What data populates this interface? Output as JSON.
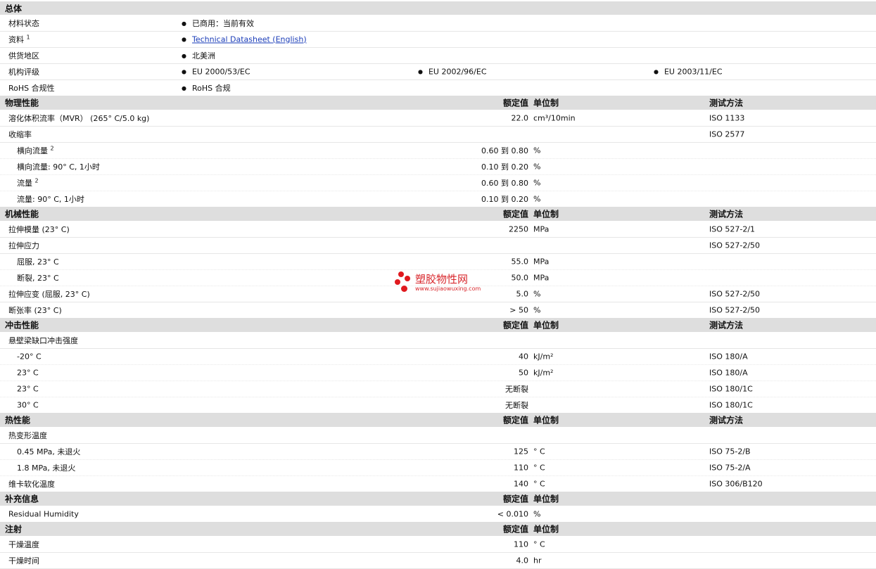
{
  "general": {
    "title": "总体",
    "rows": [
      {
        "label": "材料状态",
        "items": [
          "已商用：当前有效"
        ]
      },
      {
        "label": "资料",
        "sup": "1",
        "link": "Technical Datasheet (English)"
      },
      {
        "label": "供货地区",
        "items": [
          "北美洲"
        ]
      },
      {
        "label": "机构评级",
        "items": [
          "EU 2000/53/EC",
          "EU 2002/96/EC",
          "EU 2003/11/EC"
        ]
      },
      {
        "label": "RoHS 合规性",
        "items": [
          "RoHS 合规"
        ]
      }
    ]
  },
  "headers": {
    "value": "额定值",
    "unit": "单位制",
    "method": "测试方法"
  },
  "sections": [
    {
      "title": "物理性能",
      "has_method": true,
      "rows": [
        {
          "label": "溶化体积流率（MVR） (265° C/5.0 kg)",
          "value": "22.0",
          "unit": "cm³/10min",
          "method": "ISO 1133"
        },
        {
          "label": "收缩率",
          "value": "",
          "unit": "",
          "method": "ISO 2577"
        },
        {
          "label": "横向流量",
          "sup": "2",
          "indent": true,
          "value": "0.60 到  0.80",
          "unit": "%",
          "method": ""
        },
        {
          "label": "横向流量: 90° C, 1小时",
          "indent": true,
          "value": "0.10 到  0.20",
          "unit": "%",
          "method": ""
        },
        {
          "label": "流量",
          "sup": "2",
          "indent": true,
          "value": "0.60 到  0.80",
          "unit": "%",
          "method": ""
        },
        {
          "label": "流量: 90° C, 1小时",
          "indent": true,
          "value": "0.10 到  0.20",
          "unit": "%",
          "method": ""
        }
      ]
    },
    {
      "title": "机械性能",
      "has_method": true,
      "rows": [
        {
          "label": "拉伸模量 (23° C)",
          "value": "2250",
          "unit": "MPa",
          "method": "ISO 527-2/1"
        },
        {
          "label": "拉伸应力",
          "value": "",
          "unit": "",
          "method": "ISO 527-2/50"
        },
        {
          "label": "屈服, 23° C",
          "indent": true,
          "value": "55.0",
          "unit": "MPa",
          "method": ""
        },
        {
          "label": "断裂, 23° C",
          "indent": true,
          "value": "50.0",
          "unit": "MPa",
          "method": ""
        },
        {
          "label": "拉伸应变 (屈服, 23° C)",
          "value": "5.0",
          "unit": "%",
          "method": "ISO 527-2/50"
        },
        {
          "label": "断张率 (23° C)",
          "value": "> 50",
          "unit": "%",
          "method": "ISO 527-2/50"
        }
      ]
    },
    {
      "title": "冲击性能",
      "has_method": true,
      "rows": [
        {
          "label": "悬壁梁缺口冲击强度",
          "value": "",
          "unit": "",
          "method": ""
        },
        {
          "label": "-20° C",
          "indent": true,
          "value": "40",
          "unit": "kJ/m²",
          "method": "ISO 180/A"
        },
        {
          "label": "23° C",
          "indent": true,
          "value": "50",
          "unit": "kJ/m²",
          "method": "ISO 180/A"
        },
        {
          "label": "23° C",
          "indent": true,
          "value": "无断裂",
          "unit": "",
          "method": "ISO 180/1C"
        },
        {
          "label": "30° C",
          "indent": true,
          "value": "无断裂",
          "unit": "",
          "method": "ISO 180/1C"
        }
      ]
    },
    {
      "title": "热性能",
      "has_method": true,
      "rows": [
        {
          "label": "热变形温度",
          "value": "",
          "unit": "",
          "method": ""
        },
        {
          "label": "0.45 MPa, 未退火",
          "indent": true,
          "value": "125",
          "unit": "° C",
          "method": "ISO 75-2/B"
        },
        {
          "label": "1.8 MPa, 未退火",
          "indent": true,
          "value": "110",
          "unit": "° C",
          "method": "ISO 75-2/A"
        },
        {
          "label": "维卡软化温度",
          "value": "140",
          "unit": "° C",
          "method": "ISO 306/B120"
        }
      ]
    },
    {
      "title": "补充信息",
      "has_method": false,
      "rows": [
        {
          "label": "Residual Humidity",
          "value": "< 0.010",
          "unit": "%",
          "method": ""
        }
      ]
    },
    {
      "title": "注射",
      "has_method": false,
      "rows": [
        {
          "label": "干燥温度",
          "value": "110",
          "unit": "° C",
          "method": ""
        },
        {
          "label": "干燥时间",
          "value": "4.0",
          "unit": "hr",
          "method": ""
        }
      ]
    }
  ],
  "watermark": {
    "title": "塑胶物性网",
    "url": "www.sujiaowuxing.com",
    "color": "#e0191e"
  }
}
